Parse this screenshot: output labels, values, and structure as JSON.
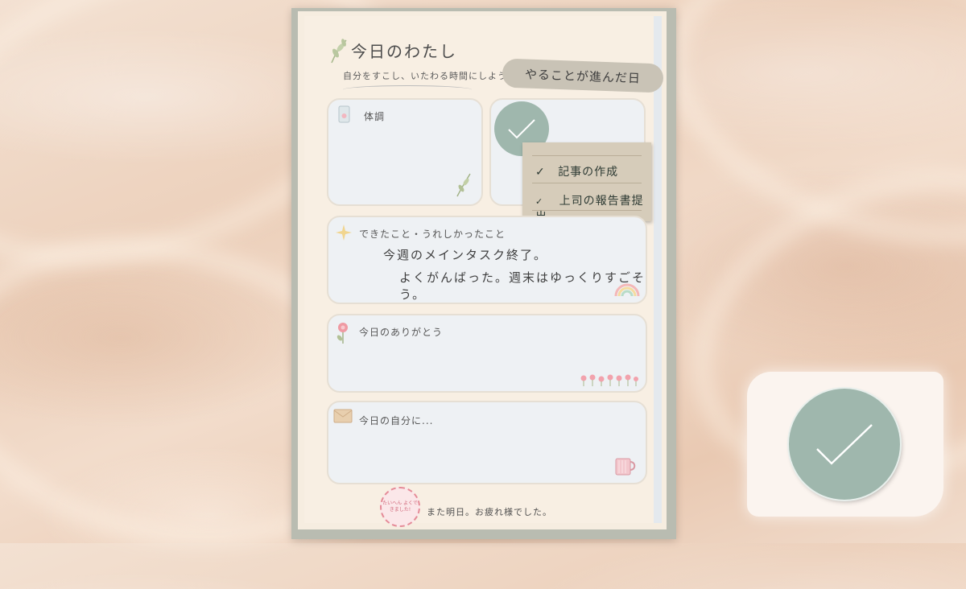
{
  "board": {
    "title": "今日のわたし",
    "subtitle": "自分をすこし、いたわる時間にしよう",
    "tag": "やることが進んだ日",
    "footer": "また明日。お疲れ様でした。",
    "stamp": "たいへん よくできました!"
  },
  "cards": {
    "condition": {
      "label": "体調"
    },
    "achievements": {
      "label": "できたこと・うれしかったこと",
      "line1": "今週のメインタスク終了。",
      "line2": "よくがんばった。週末はゆっくりすごそう。"
    },
    "thanks": {
      "label": "今日のありがとう"
    },
    "self": {
      "label": "今日の自分に..."
    }
  },
  "checklist": {
    "items": [
      {
        "check": "✓",
        "text": "記事の作成"
      },
      {
        "check": "✓",
        "text": "上司の報告書提出"
      }
    ]
  },
  "icons": {
    "leaf": "leaf-icon",
    "phone": "phone-icon",
    "sparkle": "sparkle-icon",
    "rainbow": "rainbow-icon",
    "flower": "flower-icon",
    "tulips": "tulips-icon",
    "envelope": "envelope-icon",
    "mug": "mug-icon",
    "check": "checkmark-icon"
  },
  "colors": {
    "accent_green": "#9fb7ad",
    "tag_bg": "#c9c3b6",
    "card_bg": "#eef1f4",
    "sand": "#ecd0bb"
  }
}
